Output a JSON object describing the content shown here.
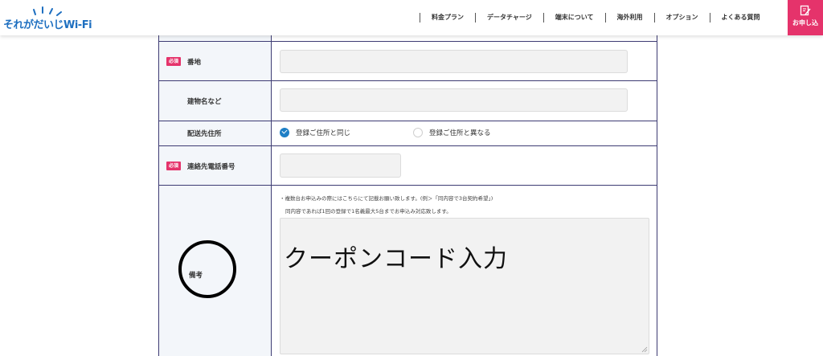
{
  "header": {
    "logo_text": "それがだいじWi-Fi",
    "nav": [
      "料金プラン",
      "データチャージ",
      "端末について",
      "海外利用",
      "オプション",
      "よくある質問"
    ],
    "apply_label": "お申し込",
    "apply_icon": "edit-form-icon",
    "accent_color": "#e5336b",
    "brand_color": "#1e6fc0"
  },
  "form": {
    "required_badge": "必須",
    "rows": {
      "banchi": {
        "label": "番地",
        "required": true,
        "value": ""
      },
      "building": {
        "label": "建物名など",
        "required": false,
        "value": ""
      },
      "delivery": {
        "label": "配送先住所",
        "options": [
          "登録ご住所と同じ",
          "登録ご住所と異なる"
        ],
        "selected": "登録ご住所と同じ"
      },
      "phone": {
        "label": "連絡先電話番号",
        "required": true,
        "value": ""
      },
      "remarks": {
        "label": "備考",
        "note_line1": "・複数台お申込みの際にはこちらにて記載お願い致します。(例＞「同内容で3台契約希望」)",
        "note_line2": "同内容であれば1回の登録で1名義最大5台までお申込み対応致します。",
        "value": "クーポンコード入力"
      }
    }
  }
}
